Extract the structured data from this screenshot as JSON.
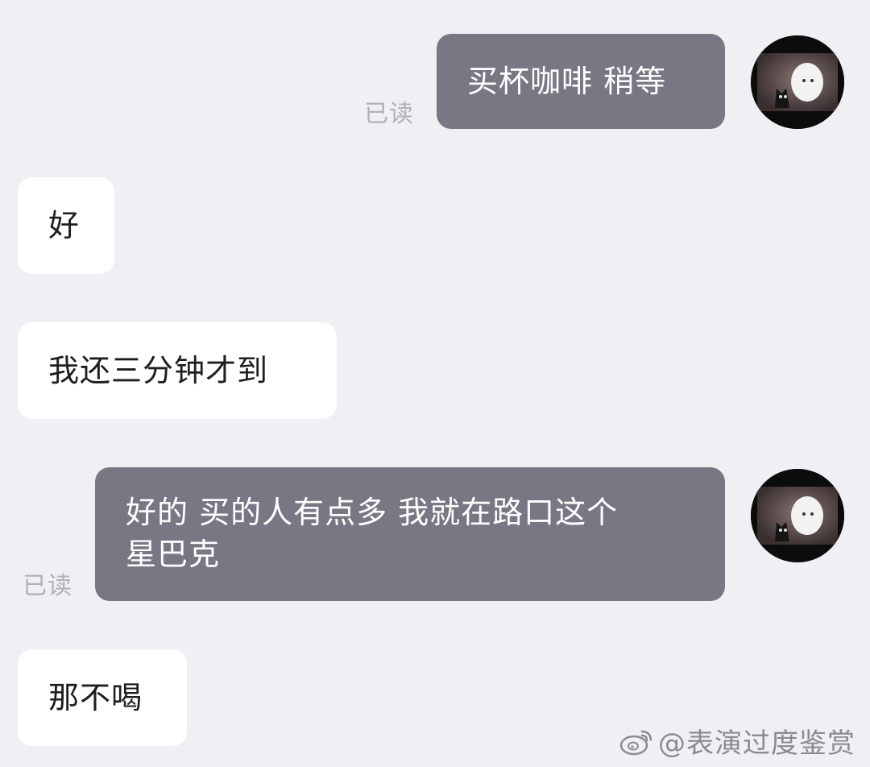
{
  "chat": {
    "messages": [
      {
        "side": "out",
        "text": "买杯咖啡 稍等",
        "status": "已读"
      },
      {
        "side": "in",
        "text": "好"
      },
      {
        "side": "in",
        "text": "我还三分钟才到"
      },
      {
        "side": "out",
        "line1": "好的 买的人有点多 我就在路口这个",
        "line2": "星巴克",
        "status": "已读"
      },
      {
        "side": "in",
        "text": "那不喝"
      }
    ]
  },
  "watermark": {
    "text": "@表演过度鉴赏"
  },
  "colors": {
    "background": "#f0f0f4",
    "outgoing_bubble": "#787885",
    "incoming_bubble": "#ffffff",
    "read_receipt": "#b0b0b6"
  },
  "icons": {
    "avatar": "avatar-cartoon-ghost-cat",
    "watermark": "weibo-icon"
  }
}
